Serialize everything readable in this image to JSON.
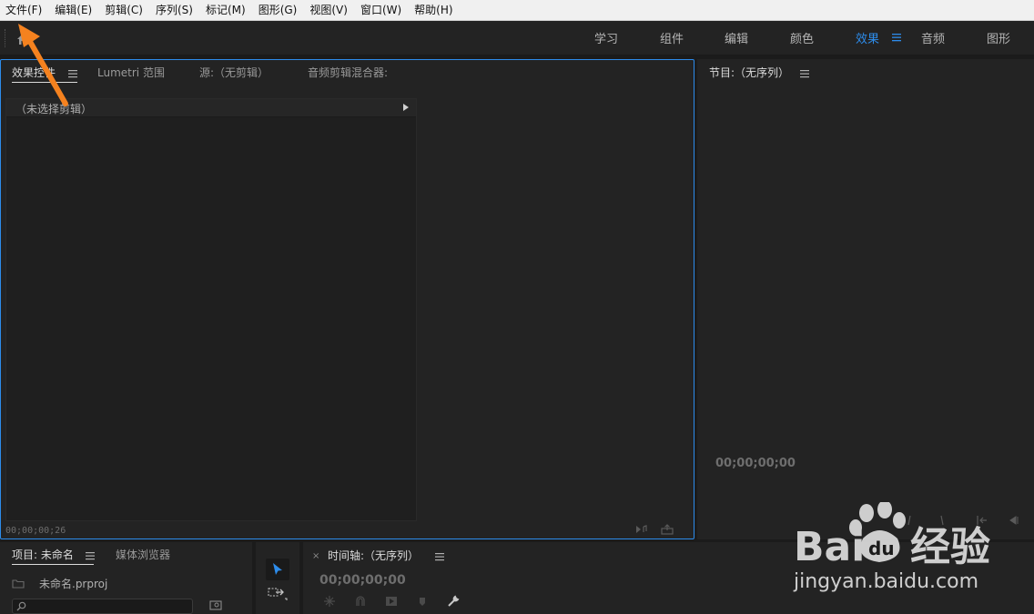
{
  "menubar": {
    "items": [
      "文件(F)",
      "编辑(E)",
      "剪辑(C)",
      "序列(S)",
      "标记(M)",
      "图形(G)",
      "视图(V)",
      "窗口(W)",
      "帮助(H)"
    ]
  },
  "workspaces": {
    "tabs": [
      "学习",
      "组件",
      "编辑",
      "颜色",
      "效果",
      "音频",
      "图形"
    ],
    "active": "效果"
  },
  "top_left_panel": {
    "tabs": [
      "效果控件",
      "Lumetri 范围",
      "源:（无剪辑）",
      "音频剪辑混合器:"
    ],
    "no_clip_text": "（未选择剪辑）",
    "timecode": "00;00;00;26"
  },
  "program_panel": {
    "title": "节目:（无序列）",
    "timecode": "00;00;00;00"
  },
  "project_panel": {
    "tabs": [
      "项目: 未命名",
      "媒体浏览器"
    ],
    "file_name": "未命名.prproj"
  },
  "timeline_panel": {
    "title": "时间轴:（无序列）",
    "timecode": "00;00;00;00"
  },
  "watermark": {
    "brand": "Bai du 经验",
    "url": "jingyan.baidu.com"
  },
  "colors": {
    "accent": "#2d8ceb",
    "annotation_arrow": "#f5821f"
  }
}
